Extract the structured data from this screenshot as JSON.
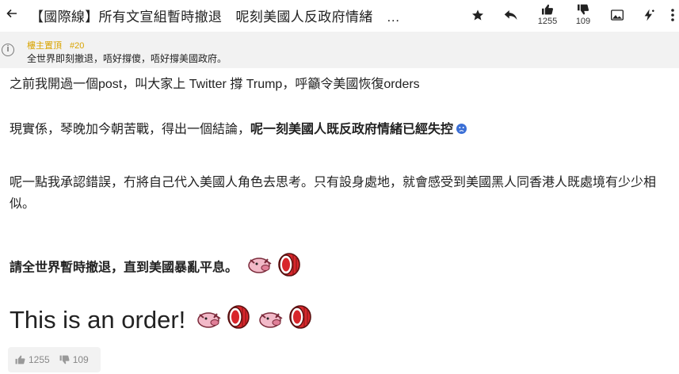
{
  "topbar": {
    "back_icon": "arrow-left-icon",
    "title": "【國際線】所有文宣組暫時撤退　呢刻美國人反政府情緒　…",
    "like_count": "1255",
    "dislike_count": "109"
  },
  "pinned": {
    "label": "樓主置頂",
    "floor": "#20",
    "text": "全世界即刻撤退，唔好撐傻，唔好撐美國政府。"
  },
  "post": {
    "p1": "之前我開過一個post，叫大家上 Twitter 撐 Trump，呼籲令美國恢復orders",
    "p2_plain": "現實係，琴晚加今朝苦戰，得出一個結論，",
    "p2_bold": "呢一刻美國人既反政府情緒已經失控",
    "p3": "呢一點我承認錯誤，冇將自己代入美國人角色去思考。只有設身處地，就會感受到美國黑人同香港人既處境有少少相似。",
    "p4": "請全世界暫時撤退，直到美國暴亂平息。",
    "p5": "This is an order!"
  },
  "footer": {
    "like_count": "1255",
    "dislike_count": "109"
  },
  "colors": {
    "pinned_label": "#d9a400",
    "pinned_bg": "#f2f2f2",
    "sad_icon": "#3b6fd6",
    "drum_red": "#d8262b"
  }
}
